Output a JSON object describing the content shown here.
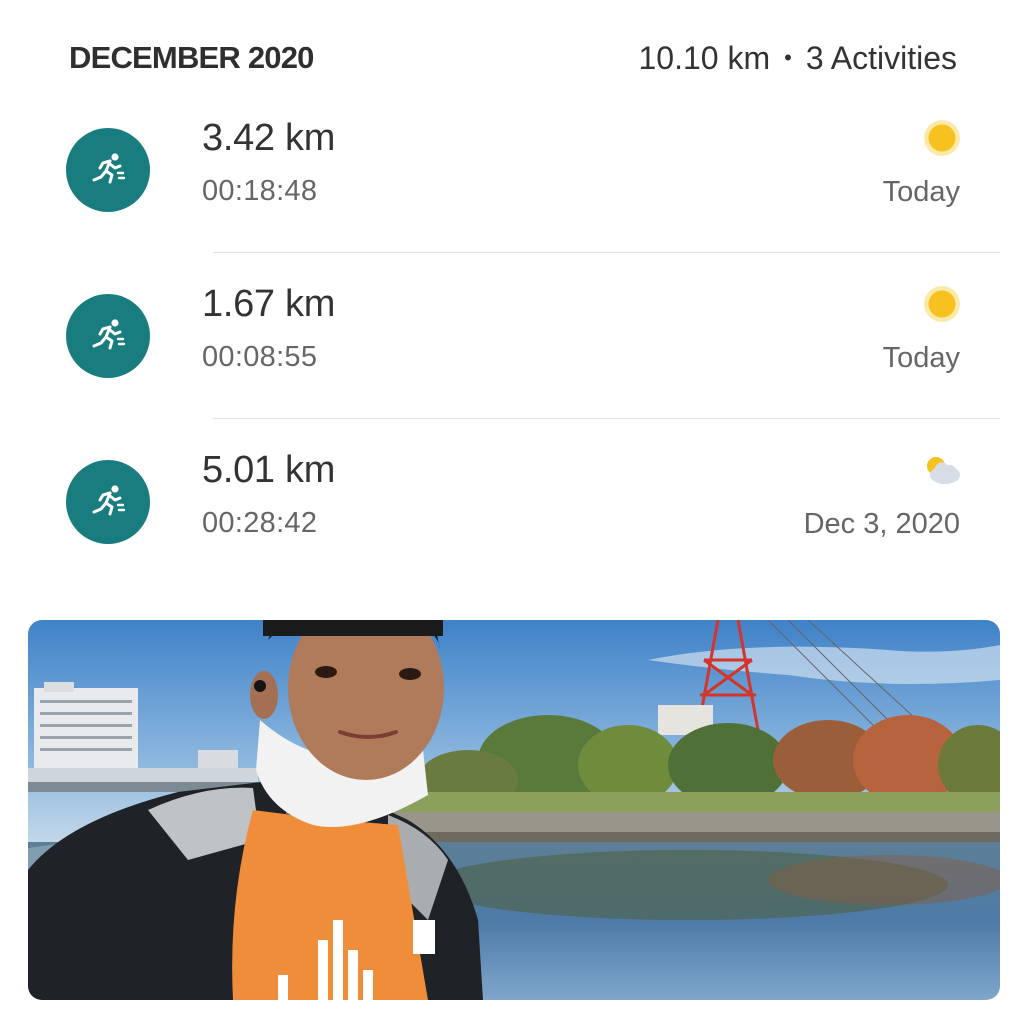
{
  "header": {
    "month": "DECEMBER 2020",
    "total_distance": "10.10 km",
    "separator": "•",
    "activity_count": "3 Activities"
  },
  "colors": {
    "accent": "#197c7e",
    "sun": "#f7c21f",
    "divider": "#e3e3e3",
    "secondary_text": "#666666"
  },
  "activities": [
    {
      "distance": "3.42 km",
      "duration": "00:18:48",
      "date": "Today",
      "weather_icon": "sun-icon",
      "activity_icon": "running-icon"
    },
    {
      "distance": "1.67 km",
      "duration": "00:08:55",
      "date": "Today",
      "weather_icon": "sun-icon",
      "activity_icon": "running-icon"
    },
    {
      "distance": "5.01 km",
      "duration": "00:28:42",
      "date": "Dec 3, 2020",
      "weather_icon": "partly-cloudy-icon",
      "activity_icon": "running-icon"
    }
  ],
  "photo": {
    "subject": "activity-photo"
  }
}
